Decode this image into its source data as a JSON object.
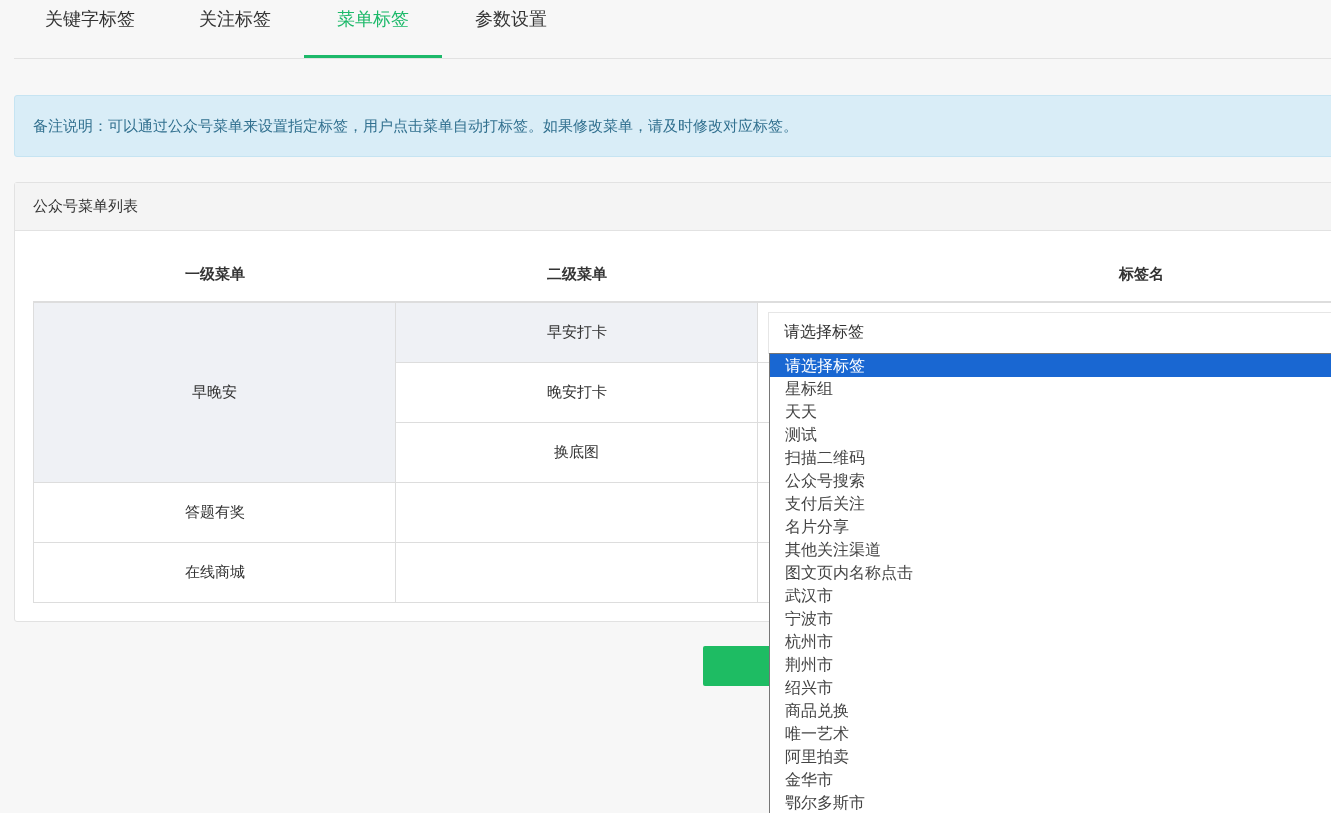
{
  "tabs": [
    {
      "label": "关键字标签",
      "selected": false
    },
    {
      "label": "关注标签",
      "selected": false
    },
    {
      "label": "菜单标签",
      "selected": true
    },
    {
      "label": "参数设置",
      "selected": false
    }
  ],
  "notice": "备注说明：可以通过公众号菜单来设置指定标签，用户点击菜单自动打标签。如果修改菜单，请及时修改对应标签。",
  "panel": {
    "title": "公众号菜单列表",
    "table": {
      "columns": [
        "一级菜单",
        "二级菜单",
        "标签名"
      ],
      "rows": [
        {
          "name": "早晚安",
          "highlighted": true,
          "children": [
            {
              "name": "早安打卡",
              "highlighted": true
            },
            {
              "name": "晚安打卡",
              "highlighted": false
            },
            {
              "name": "换底图",
              "highlighted": false
            }
          ]
        },
        {
          "name": "答题有奖",
          "highlighted": false,
          "children": []
        },
        {
          "name": "在线商城",
          "highlighted": false,
          "children": []
        }
      ]
    },
    "select": {
      "value": "请选择标签",
      "expanded": true,
      "options": [
        {
          "label": "请选择标签",
          "selected": true
        },
        {
          "label": "星标组",
          "selected": false
        },
        {
          "label": "天天",
          "selected": false
        },
        {
          "label": "测试",
          "selected": false
        },
        {
          "label": "扫描二维码",
          "selected": false
        },
        {
          "label": "公众号搜索",
          "selected": false
        },
        {
          "label": "支付后关注",
          "selected": false
        },
        {
          "label": "名片分享",
          "selected": false
        },
        {
          "label": "其他关注渠道",
          "selected": false
        },
        {
          "label": "图文页内名称点击",
          "selected": false
        },
        {
          "label": "武汉市",
          "selected": false
        },
        {
          "label": "宁波市",
          "selected": false
        },
        {
          "label": "杭州市",
          "selected": false
        },
        {
          "label": "荆州市",
          "selected": false
        },
        {
          "label": "绍兴市",
          "selected": false
        },
        {
          "label": "商品兑换",
          "selected": false
        },
        {
          "label": "唯一艺术",
          "selected": false
        },
        {
          "label": "阿里拍卖",
          "selected": false
        },
        {
          "label": "金华市",
          "selected": false
        },
        {
          "label": "鄂尔多斯市",
          "selected": false
        }
      ]
    }
  }
}
